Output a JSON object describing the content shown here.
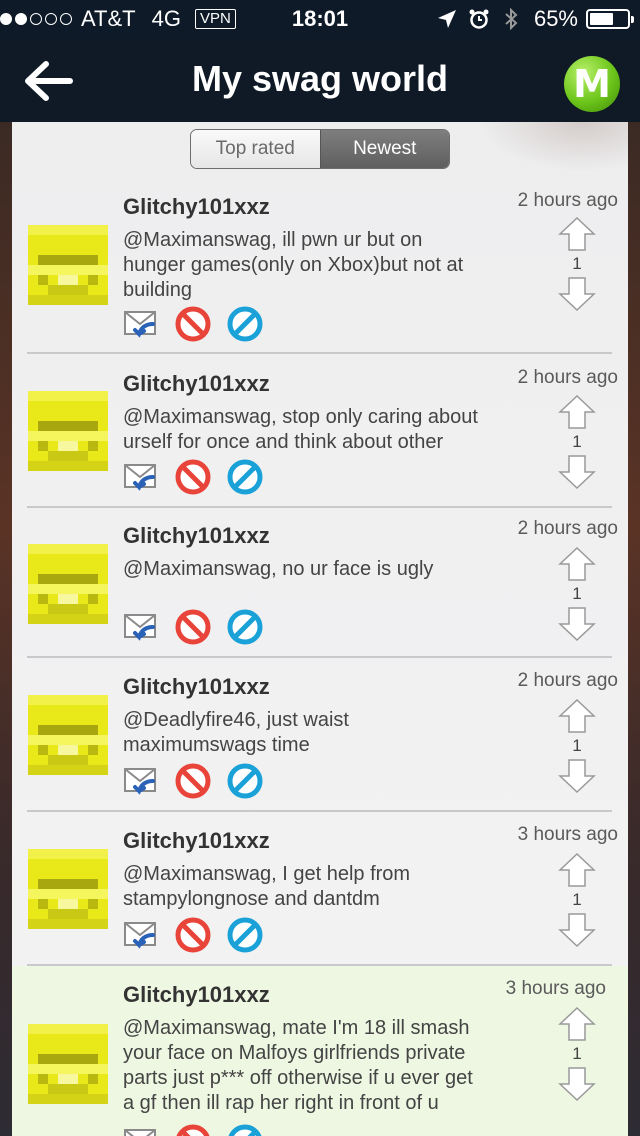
{
  "status_bar": {
    "carrier": "AT&T",
    "network": "4G",
    "vpn": "VPN",
    "time": "18:01",
    "battery_percent": "65%",
    "battery_level": 0.65
  },
  "nav": {
    "title": "My swag world",
    "logo_letter": "M"
  },
  "tabs": [
    {
      "label": "Top rated",
      "active": false
    },
    {
      "label": "Newest",
      "active": true
    }
  ],
  "comments": [
    {
      "user": "Glitchy101xxz",
      "time": "2 hours ago",
      "lines": [
        "@Maximanswag, ill pwn ur but on",
        "hunger games(only on Xbox)but not at",
        "building"
      ],
      "votes": "1"
    },
    {
      "user": "Glitchy101xxz",
      "time": "2 hours ago",
      "lines": [
        "@Maximanswag, stop only caring about",
        "urself for once and think about other"
      ],
      "votes": "1"
    },
    {
      "user": "Glitchy101xxz",
      "time": "2 hours ago",
      "lines": [
        "@Maximanswag, no ur face is ugly"
      ],
      "votes": "1"
    },
    {
      "user": "Glitchy101xxz",
      "time": "2 hours ago",
      "lines": [
        "@Deadlyfire46, just waist",
        "maximumswags time"
      ],
      "votes": "1"
    },
    {
      "user": "Glitchy101xxz",
      "time": "3 hours ago",
      "lines": [
        "@Maximanswag, I get help from",
        "stampylongnose and dantdm"
      ],
      "votes": "1"
    },
    {
      "user": "Glitchy101xxz",
      "time": "3 hours ago",
      "lines": [
        "@Maximanswag, mate I'm 18 ill smash",
        "your face on Malfoys girlfriends private",
        "parts just p*** off otherwise if u ever get",
        "a gf then ill rap her right in front of u"
      ],
      "votes": "1"
    }
  ],
  "icons": {
    "back": "back-arrow-icon",
    "reply": "reply-envelope-icon",
    "report": "report-icon",
    "block": "block-icon",
    "upvote": "upvote-arrow-icon",
    "downvote": "downvote-arrow-icon"
  },
  "colors": {
    "nav_bg": "#0f1a26",
    "logo_green": "#6cc51a",
    "report_red": "#e8443a",
    "block_blue": "#1aa2d8",
    "highlight_bg": "#eef7e2",
    "avatar_yellow": "#e9e818"
  }
}
